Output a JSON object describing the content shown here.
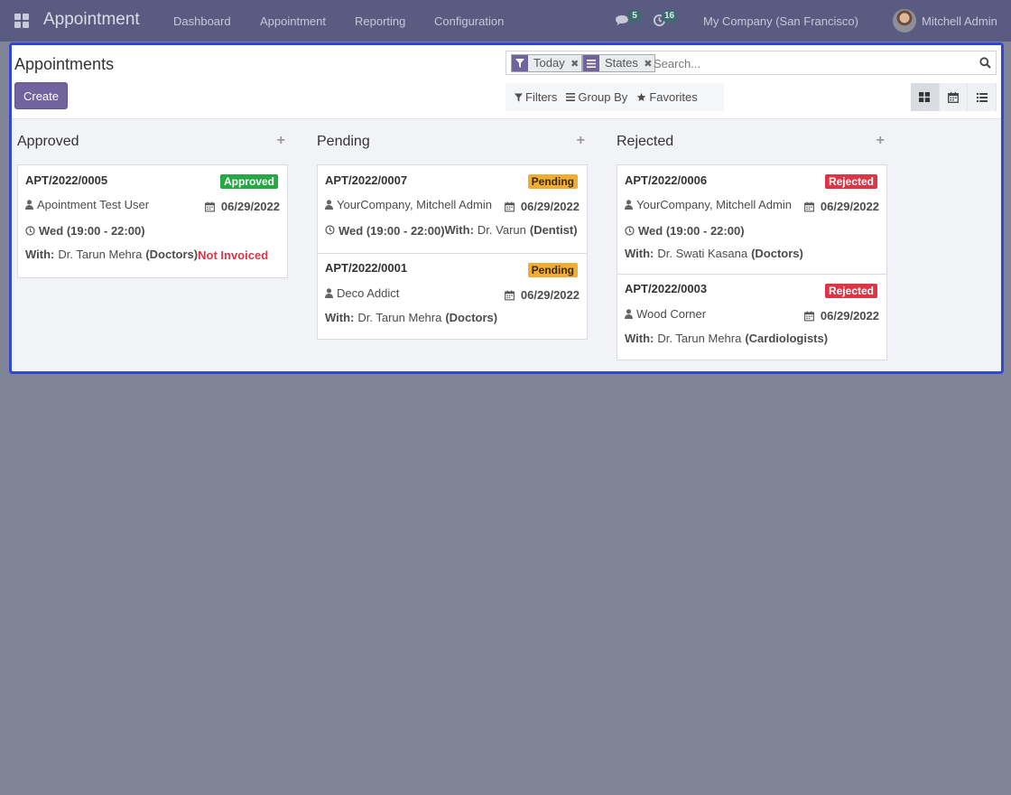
{
  "navbar": {
    "app_name": "Appointment",
    "menu": [
      "Dashboard",
      "Appointment",
      "Reporting",
      "Configuration"
    ],
    "messages_count": "5",
    "activities_count": "16",
    "company": "My Company (San Francisco)",
    "user": "Mitchell Admin"
  },
  "control_panel": {
    "title": "Appointments",
    "create_label": "Create",
    "facets": [
      {
        "label": "Today"
      },
      {
        "label": "States"
      }
    ],
    "search_placeholder": "Search...",
    "filters_label": "Filters",
    "groupby_label": "Group By",
    "favorites_label": "Favorites"
  },
  "kanban": {
    "columns": [
      {
        "title": "Approved",
        "cards": [
          {
            "ref": "APT/2022/0005",
            "state": "Approved",
            "customer": "Apointment Test User",
            "date": "06/29/2022",
            "slot": "Wed (19:00 - 22:00)",
            "with_label": "With:",
            "doctor": "Dr. Tarun Mehra",
            "specialty": "(Doctors)",
            "invoice_status": "Not Invoiced"
          }
        ]
      },
      {
        "title": "Pending",
        "cards": [
          {
            "ref": "APT/2022/0007",
            "state": "Pending",
            "customer": "YourCompany, Mitchell Admin",
            "date": "06/29/2022",
            "slot": "Wed (19:00 - 22:00)",
            "with_label": "With:",
            "doctor": "Dr. Varun",
            "specialty": "(Dentist)"
          },
          {
            "ref": "APT/2022/0001",
            "state": "Pending",
            "customer": "Deco Addict",
            "date": "06/29/2022",
            "with_label": "With:",
            "doctor": "Dr. Tarun Mehra",
            "specialty": "(Doctors)"
          }
        ]
      },
      {
        "title": "Rejected",
        "cards": [
          {
            "ref": "APT/2022/0006",
            "state": "Rejected",
            "customer": "YourCompany, Mitchell Admin",
            "date": "06/29/2022",
            "slot": "Wed (19:00 - 22:00)",
            "with_label": "With:",
            "doctor": "Dr. Swati Kasana",
            "specialty": "(Doctors)"
          },
          {
            "ref": "APT/2022/0003",
            "state": "Rejected",
            "customer": "Wood Corner",
            "date": "06/29/2022",
            "with_label": "With:",
            "doctor": "Dr. Tarun Mehra",
            "specialty": "(Cardiologists)"
          }
        ]
      }
    ]
  },
  "colors": {
    "navbar": "#5a5b80",
    "primary": "#71639e",
    "approved": "#28a745",
    "pending": "#f0ad33",
    "rejected": "#dc3545",
    "highlight_frame": "#2f46d8"
  },
  "icons": {
    "apps": "apps-grid-icon",
    "messages": "chat-icon",
    "activities": "clock-icon",
    "facet_today": "filter-icon",
    "facet_states": "list-icon",
    "facet_remove": "close-icon",
    "search": "search-icon",
    "filters": "filter-icon",
    "groupby": "bars-icon",
    "favorites": "star-icon",
    "kanban_view": "kanban-icon",
    "calendar_view": "calendar-icon",
    "list_view": "list-icon"
  }
}
